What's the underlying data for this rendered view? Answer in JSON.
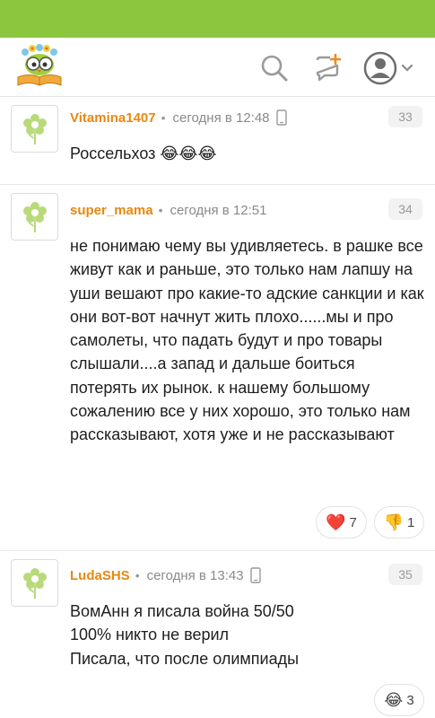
{
  "colors": {
    "accent": "#8cc63f",
    "author": "#e8880f"
  },
  "header": {
    "logo_icon": "owl-on-books-logo",
    "search_icon": "search-icon",
    "compose_icon": "new-message-icon",
    "profile_icon": "user-avatar-icon"
  },
  "comments": [
    {
      "author": "Vitamina1407",
      "dot": "•",
      "time": "сегодня в 12:48",
      "device": "phone-icon",
      "number": "33",
      "text": "Россельхоз 😂😂😂",
      "reactions": []
    },
    {
      "author": "super_mama",
      "dot": "•",
      "time": "сегодня в 12:51",
      "number": "34",
      "text": "не понимаю чему вы удивляетесь. в рашке все живут как и раньше, это только нам лапшу на уши вешают про какие-то адские санкции и как они вот-вот начнут жить плохо......мы и про самолеты, что падать будут и про товары слышали....а запад и дальше боиться потерять их рынок. к нашему большому сожалению все у них хорошо, это только нам рассказывают, хотя уже и не рассказывают",
      "reactions": [
        {
          "emoji": "❤️",
          "count": "7"
        },
        {
          "emoji": "👎",
          "count": "1"
        }
      ]
    },
    {
      "author": "LudaSHS",
      "dot": "•",
      "time": "сегодня в 13:43",
      "device": "phone-icon",
      "number": "35",
      "lines": [
        "ВомАнн я писала война 50/50",
        "100% никто не верил",
        "Писала, что после олимпиады"
      ],
      "reactions": [
        {
          "emoji": "😂",
          "count": "3"
        }
      ]
    }
  ]
}
